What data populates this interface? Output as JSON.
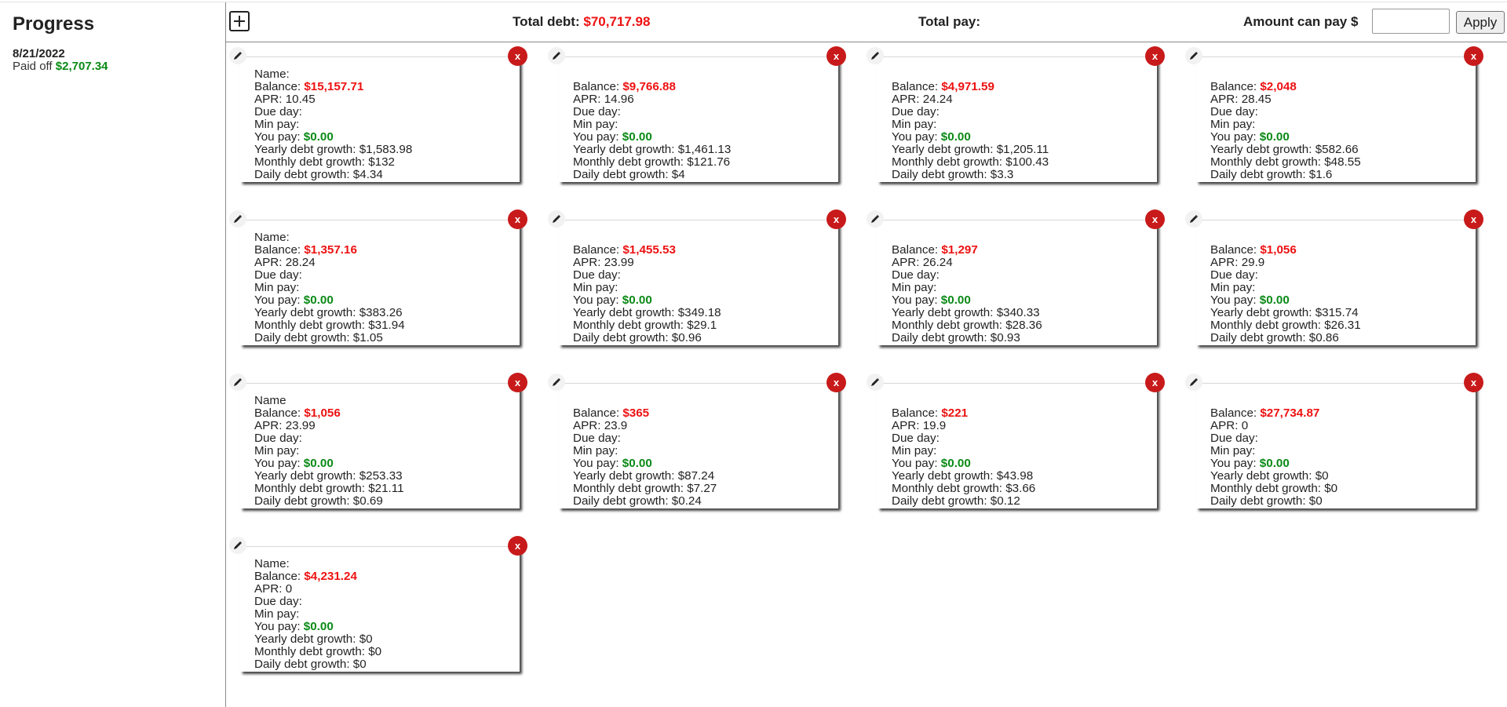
{
  "sidebar": {
    "title": "Progress",
    "date": "8/21/2022",
    "paid_off_label": "Paid off",
    "paid_off_value": "$2,707.34"
  },
  "header": {
    "total_debt_label": "Total debt:",
    "total_debt_value": "$70,717.98",
    "total_pay_label": "Total pay:",
    "amount_can_pay_label": "Amount can pay $",
    "amount_input_value": "",
    "apply_label": "Apply"
  },
  "labels": {
    "name": "Name:",
    "balance": "Balance:",
    "apr": "APR:",
    "due_day": "Due day:",
    "min_pay": "Min pay:",
    "you_pay": "You pay:",
    "yearly": "Yearly debt growth:",
    "monthly": "Monthly debt growth:",
    "daily": "Daily debt growth:",
    "delete": "x"
  },
  "colors": {
    "balance": "#ee1111",
    "you_pay": "#0a8a16",
    "delete_button": "#c81a1a"
  },
  "debts": [
    {
      "name_label": "Name:",
      "balance": "$15,157.71",
      "apr": "10.45",
      "you_pay": "$0.00",
      "yearly": "$1,583.98",
      "monthly": "$132",
      "daily": "$4.34"
    },
    {
      "name_label": "",
      "balance": "$9,766.88",
      "apr": "14.96",
      "you_pay": "$0.00",
      "yearly": "$1,461.13",
      "monthly": "$121.76",
      "daily": "$4"
    },
    {
      "name_label": "",
      "balance": "$4,971.59",
      "apr": "24.24",
      "you_pay": "$0.00",
      "yearly": "$1,205.11",
      "monthly": "$100.43",
      "daily": "$3.3"
    },
    {
      "name_label": "",
      "balance": "$2,048",
      "apr": "28.45",
      "you_pay": "$0.00",
      "yearly": "$582.66",
      "monthly": "$48.55",
      "daily": "$1.6"
    },
    {
      "name_label": "Name:",
      "balance": "$1,357.16",
      "apr": "28.24",
      "you_pay": "$0.00",
      "yearly": "$383.26",
      "monthly": "$31.94",
      "daily": "$1.05"
    },
    {
      "name_label": "",
      "balance": "$1,455.53",
      "apr": "23.99",
      "you_pay": "$0.00",
      "yearly": "$349.18",
      "monthly": "$29.1",
      "daily": "$0.96"
    },
    {
      "name_label": "",
      "balance": "$1,297",
      "apr": "26.24",
      "you_pay": "$0.00",
      "yearly": "$340.33",
      "monthly": "$28.36",
      "daily": "$0.93"
    },
    {
      "name_label": "",
      "balance": "$1,056",
      "apr": "29.9",
      "you_pay": "$0.00",
      "yearly": "$315.74",
      "monthly": "$26.31",
      "daily": "$0.86"
    },
    {
      "name_label": "Name",
      "balance": "$1,056",
      "apr": "23.99",
      "you_pay": "$0.00",
      "yearly": "$253.33",
      "monthly": "$21.11",
      "daily": "$0.69"
    },
    {
      "name_label": "",
      "balance": "$365",
      "apr": "23.9",
      "you_pay": "$0.00",
      "yearly": "$87.24",
      "monthly": "$7.27",
      "daily": "$0.24"
    },
    {
      "name_label": "",
      "balance": "$221",
      "apr": "19.9",
      "you_pay": "$0.00",
      "yearly": "$43.98",
      "monthly": "$3.66",
      "daily": "$0.12"
    },
    {
      "name_label": "",
      "balance": "$27,734.87",
      "apr": "0",
      "you_pay": "$0.00",
      "yearly": "$0",
      "monthly": "$0",
      "daily": "$0"
    },
    {
      "name_label": "Name:",
      "balance": "$4,231.24",
      "apr": "0",
      "you_pay": "$0.00",
      "yearly": "$0",
      "monthly": "$0",
      "daily": "$0"
    }
  ]
}
